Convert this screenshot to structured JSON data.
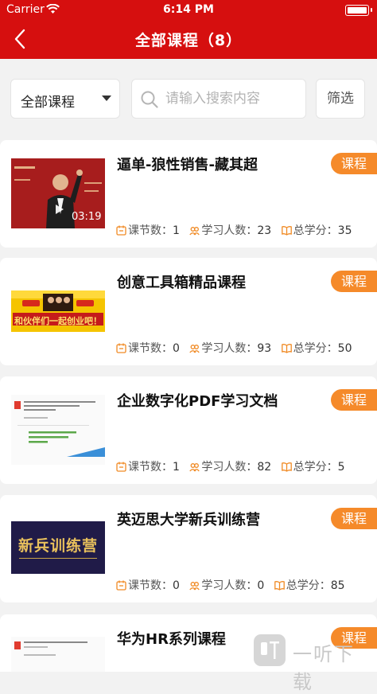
{
  "status_bar": {
    "carrier": "Carrier",
    "time": "6:14 PM"
  },
  "header": {
    "title": "全部课程（8）"
  },
  "toolbar": {
    "category": "全部课程",
    "search_placeholder": "请输入搜索内容",
    "filter_label": "筛选"
  },
  "labels": {
    "lessons": "课节数：",
    "learners": "学习人数：",
    "credits": "总学分："
  },
  "courses": [
    {
      "title": "逼单-狼性销售-藏其超",
      "badge": "课程",
      "lessons": "1",
      "learners": "23",
      "credits": "35",
      "thumb_duration": "03:19"
    },
    {
      "title": "创意工具箱精品课程",
      "badge": "课程",
      "lessons": "0",
      "learners": "93",
      "credits": "50",
      "thumb_text": "和伙伴们一起创业吧！"
    },
    {
      "title": "企业数字化PDF学习文档",
      "badge": "课程",
      "lessons": "1",
      "learners": "82",
      "credits": "5"
    },
    {
      "title": "英迈思大学新兵训练营",
      "badge": "课程",
      "lessons": "0",
      "learners": "0",
      "credits": "85",
      "thumb_text": "新兵训练营"
    },
    {
      "title": "华为HR系列课程",
      "badge": "课程"
    }
  ],
  "watermark": {
    "text": "一听下载"
  },
  "colors": {
    "brand_red": "#d60f0f",
    "badge_orange": "#f58a2a",
    "stat_icon": "#f08a24"
  }
}
